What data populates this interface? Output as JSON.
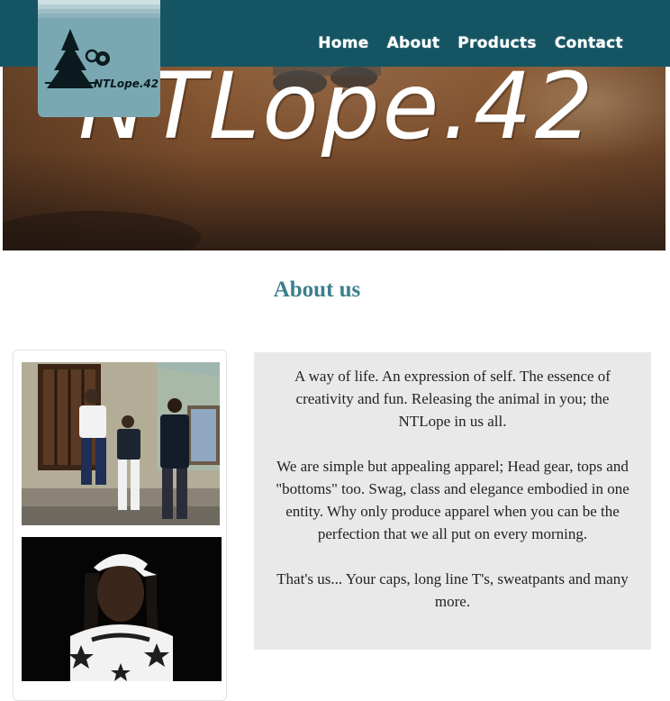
{
  "nav": {
    "brand_text": "NTLope.42",
    "links": [
      "Home",
      "About",
      "Products",
      "Contact"
    ]
  },
  "hero": {
    "title": "NTLope.42"
  },
  "about": {
    "heading": "About us",
    "paragraphs": [
      "A way of life. An expression of self. The essence of creativity and fun. Releasing the animal in you; the NTLope in us all.",
      "We are simple but appealing apparel; Head gear, tops and \"bottoms\" too. Swag, class and elegance embodied in one entity. Why only produce apparel when you can be the perfection that we all put on every morning.",
      "That's us... Your caps, long line T's, sweatpants and many more."
    ]
  },
  "gallery": {
    "photos": [
      "group-photo",
      "brooklyn-shirt-photo"
    ]
  },
  "colors": {
    "nav_bg": "#155563",
    "logo_bg": "#7aa8b2",
    "heading": "#3b7f8d",
    "about_bg": "#e9e9e9"
  }
}
